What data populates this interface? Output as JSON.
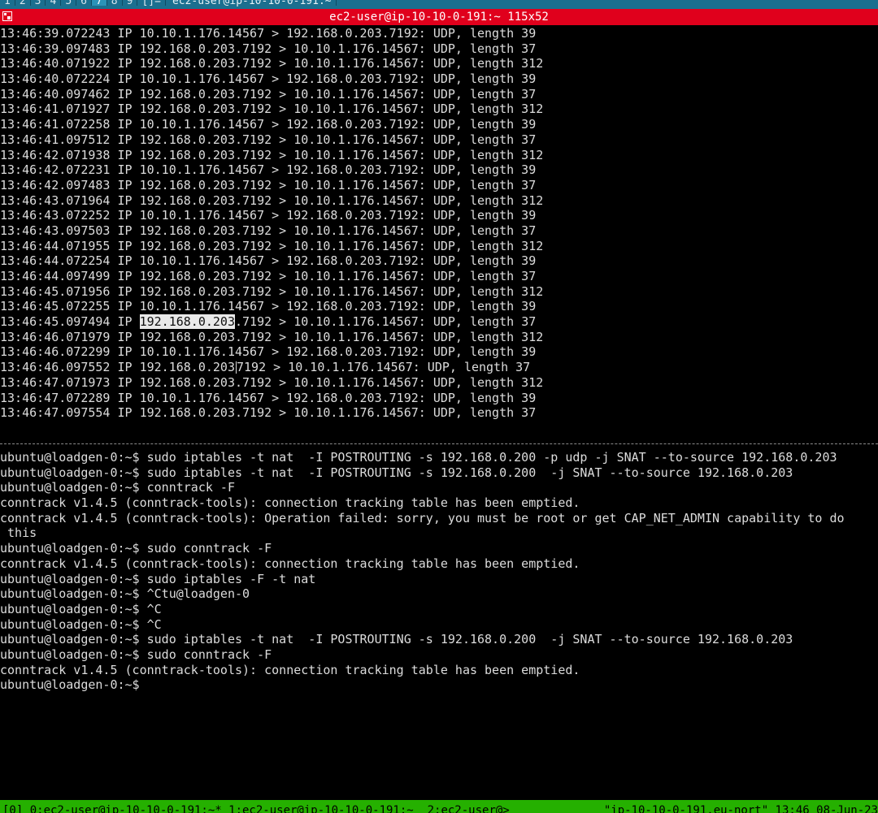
{
  "tabbar": {
    "tabs": [
      "1",
      "2",
      "3",
      "4",
      "5",
      "6",
      "7",
      "8",
      "9",
      "[]="
    ],
    "active_tab": "7",
    "window_label": "ec2-user@ip-10-10-0-191:~"
  },
  "titlebar": {
    "title": "ec2-user@ip-10-10-0-191:~ 115x52"
  },
  "top_pane": {
    "lines": [
      "13:46:39.072243 IP 10.10.1.176.14567 > 192.168.0.203.7192: UDP, length 39",
      "13:46:39.097483 IP 192.168.0.203.7192 > 10.10.1.176.14567: UDP, length 37",
      "13:46:40.071922 IP 192.168.0.203.7192 > 10.10.1.176.14567: UDP, length 312",
      "13:46:40.072224 IP 10.10.1.176.14567 > 192.168.0.203.7192: UDP, length 39",
      "13:46:40.097462 IP 192.168.0.203.7192 > 10.10.1.176.14567: UDP, length 37",
      "13:46:41.071927 IP 192.168.0.203.7192 > 10.10.1.176.14567: UDP, length 312",
      "13:46:41.072258 IP 10.10.1.176.14567 > 192.168.0.203.7192: UDP, length 39",
      "13:46:41.097512 IP 192.168.0.203.7192 > 10.10.1.176.14567: UDP, length 37",
      "13:46:42.071938 IP 192.168.0.203.7192 > 10.10.1.176.14567: UDP, length 312",
      "13:46:42.072231 IP 10.10.1.176.14567 > 192.168.0.203.7192: UDP, length 39",
      "13:46:42.097483 IP 192.168.0.203.7192 > 10.10.1.176.14567: UDP, length 37",
      "13:46:43.071964 IP 192.168.0.203.7192 > 10.10.1.176.14567: UDP, length 312",
      "13:46:43.072252 IP 10.10.1.176.14567 > 192.168.0.203.7192: UDP, length 39",
      "13:46:43.097503 IP 192.168.0.203.7192 > 10.10.1.176.14567: UDP, length 37",
      "13:46:44.071955 IP 192.168.0.203.7192 > 10.10.1.176.14567: UDP, length 312",
      "13:46:44.072254 IP 10.10.1.176.14567 > 192.168.0.203.7192: UDP, length 39",
      "13:46:44.097499 IP 192.168.0.203.7192 > 10.10.1.176.14567: UDP, length 37",
      "13:46:45.071956 IP 192.168.0.203.7192 > 10.10.1.176.14567: UDP, length 312",
      "13:46:45.072255 IP 10.10.1.176.14567 > 192.168.0.203.7192: UDP, length 39",
      "13:46:45.097494 IP 192.168.0.203.7192 > 10.10.1.176.14567: UDP, length 37",
      "13:46:46.071979 IP 192.168.0.203.7192 > 10.10.1.176.14567: UDP, length 312",
      "13:46:46.072299 IP 10.10.1.176.14567 > 192.168.0.203.7192: UDP, length 39",
      "13:46:46.097552 IP 192.168.0.203.7192 > 10.10.1.176.14567: UDP, length 37",
      "13:46:47.071973 IP 192.168.0.203.7192 > 10.10.1.176.14567: UDP, length 312",
      "13:46:47.072289 IP 10.10.1.176.14567 > 192.168.0.203.7192: UDP, length 39",
      "13:46:47.097554 IP 192.168.0.203.7192 > 10.10.1.176.14567: UDP, length 37"
    ],
    "selection": {
      "line": 19,
      "text": "192.168.0.203"
    },
    "ibeam_line": 22
  },
  "bottom_pane": {
    "lines": [
      "ubuntu@loadgen-0:~$ sudo iptables -t nat  -I POSTROUTING -s 192.168.0.200 -p udp -j SNAT --to-source 192.168.0.203",
      "ubuntu@loadgen-0:~$ sudo iptables -t nat  -I POSTROUTING -s 192.168.0.200  -j SNAT --to-source 192.168.0.203",
      "ubuntu@loadgen-0:~$ conntrack -F",
      "conntrack v1.4.5 (conntrack-tools): connection tracking table has been emptied.",
      "conntrack v1.4.5 (conntrack-tools): Operation failed: sorry, you must be root or get CAP_NET_ADMIN capability to do",
      " this",
      "ubuntu@loadgen-0:~$ sudo conntrack -F",
      "conntrack v1.4.5 (conntrack-tools): connection tracking table has been emptied.",
      "ubuntu@loadgen-0:~$ sudo iptables -F -t nat",
      "ubuntu@loadgen-0:~$ ^Ctu@loadgen-0",
      "ubuntu@loadgen-0:~$ ^C",
      "ubuntu@loadgen-0:~$ ^C",
      "ubuntu@loadgen-0:~$ sudo iptables -t nat  -I POSTROUTING -s 192.168.0.200  -j SNAT --to-source 192.168.0.203",
      "ubuntu@loadgen-0:~$ sudo conntrack -F",
      "conntrack v1.4.5 (conntrack-tools): connection tracking table has been emptied.",
      "ubuntu@loadgen-0:~$"
    ]
  },
  "statusbar": {
    "left": "[0] 0:ec2-user@ip-10-10-0-191:~* 1:ec2-user@ip-10-10-0-191:~  2:ec2-user@>",
    "right": "\"ip-10-10-0-191.eu-nort\" 13:46 08-Jun-23"
  },
  "colors": {
    "tabbar_bg": "#1b6f8f",
    "titlebar_bg": "#e0001c",
    "terminal_bg": "#000000",
    "statusbar_bg": "#25b000"
  }
}
